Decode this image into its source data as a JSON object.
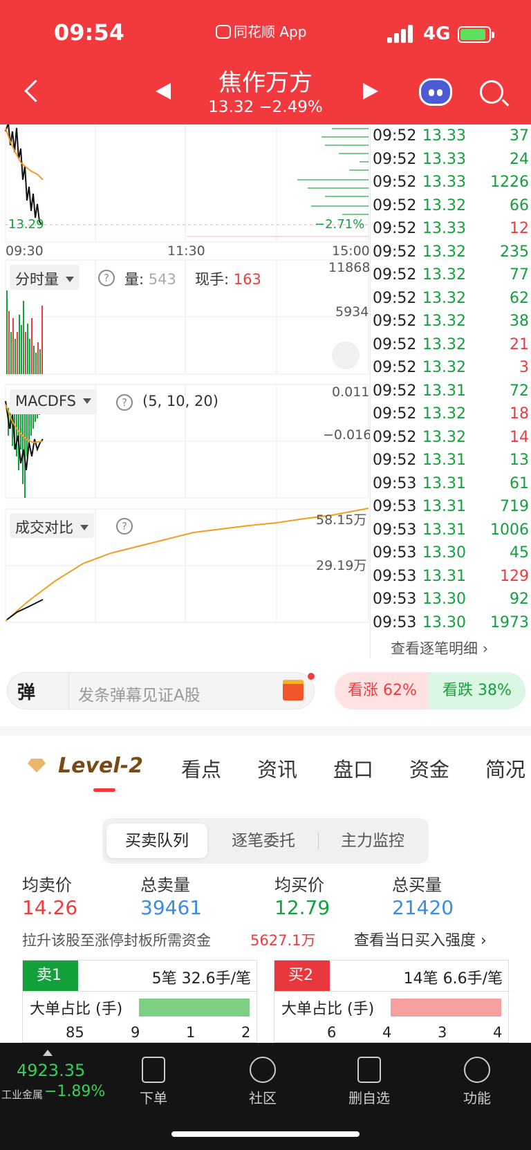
{
  "status": {
    "time": "09:54",
    "app": "同花顺 App",
    "network": "4G"
  },
  "header": {
    "title": "焦作万方",
    "price_change": "13.32  −2.49%"
  },
  "chart": {
    "price_label": "13.29",
    "pct_label": "−2.71%",
    "time_start": "09:30",
    "time_mid": "11:30",
    "time_end": "15:00",
    "volume_panel": {
      "selector": "分时量",
      "vol_label": "量:",
      "vol_value": "543",
      "cur_label": "现手:",
      "cur_value": "163",
      "axis_top": "11868",
      "axis_mid": "5934"
    },
    "macd_panel": {
      "selector": "MACDFS",
      "params": "(5, 10, 20)",
      "axis_top": "0.011",
      "axis_mid": "−0.016"
    },
    "compare_panel": {
      "selector": "成交对比",
      "axis_top": "58.15万",
      "axis_mid": "29.19万"
    },
    "colors": {
      "up": "#f2393d",
      "down": "#12a13a",
      "avg": "#f39c1f"
    }
  },
  "ticks": {
    "rows": [
      {
        "time": "09:52",
        "price": "13.33",
        "vol": "37",
        "dir": "down"
      },
      {
        "time": "09:52",
        "price": "13.33",
        "vol": "24",
        "dir": "down"
      },
      {
        "time": "09:52",
        "price": "13.33",
        "vol": "1226",
        "dir": "down"
      },
      {
        "time": "09:52",
        "price": "13.32",
        "vol": "66",
        "dir": "down"
      },
      {
        "time": "09:52",
        "price": "13.33",
        "vol": "12",
        "dir": "up"
      },
      {
        "time": "09:52",
        "price": "13.32",
        "vol": "235",
        "dir": "down"
      },
      {
        "time": "09:52",
        "price": "13.32",
        "vol": "77",
        "dir": "down"
      },
      {
        "time": "09:52",
        "price": "13.32",
        "vol": "62",
        "dir": "down"
      },
      {
        "time": "09:52",
        "price": "13.32",
        "vol": "38",
        "dir": "down"
      },
      {
        "time": "09:52",
        "price": "13.32",
        "vol": "21",
        "dir": "up"
      },
      {
        "time": "09:52",
        "price": "13.32",
        "vol": "3",
        "dir": "up"
      },
      {
        "time": "09:52",
        "price": "13.31",
        "vol": "72",
        "dir": "down"
      },
      {
        "time": "09:52",
        "price": "13.32",
        "vol": "18",
        "dir": "up"
      },
      {
        "time": "09:52",
        "price": "13.32",
        "vol": "14",
        "dir": "up"
      },
      {
        "time": "09:52",
        "price": "13.31",
        "vol": "13",
        "dir": "down"
      },
      {
        "time": "09:53",
        "price": "13.31",
        "vol": "61",
        "dir": "down"
      },
      {
        "time": "09:53",
        "price": "13.31",
        "vol": "719",
        "dir": "down"
      },
      {
        "time": "09:53",
        "price": "13.31",
        "vol": "1006",
        "dir": "down"
      },
      {
        "time": "09:53",
        "price": "13.30",
        "vol": "45",
        "dir": "down"
      },
      {
        "time": "09:53",
        "price": "13.31",
        "vol": "129",
        "dir": "up"
      },
      {
        "time": "09:53",
        "price": "13.30",
        "vol": "92",
        "dir": "down"
      },
      {
        "time": "09:53",
        "price": "13.30",
        "vol": "1973",
        "dir": "down"
      }
    ],
    "more": "查看逐笔明细"
  },
  "danmu": {
    "icon": "弹",
    "placeholder": "发条弹幕见证A股",
    "rise": "看涨 62%",
    "fall": "看跌 38%"
  },
  "tabs": {
    "level2": "Level-2",
    "items": [
      "看点",
      "资讯",
      "盘口",
      "资金",
      "简况"
    ]
  },
  "segments": [
    "买卖队列",
    "逐笔委托",
    "主力监控"
  ],
  "stats": [
    {
      "label": "均卖价",
      "value": "14.26",
      "color": "#f2393d"
    },
    {
      "label": "总卖量",
      "value": "39461",
      "color": "#3a8be6"
    },
    {
      "label": "均买价",
      "value": "12.79",
      "color": "#12a13a"
    },
    {
      "label": "总买量",
      "value": "21420",
      "color": "#3a8be6"
    }
  ],
  "note": {
    "text": "拉升该股至涨停封板所需资金",
    "value": "5627.1万",
    "link": "查看当日买入强度"
  },
  "queues": [
    {
      "head": "卖1",
      "head_color": "#12a13a",
      "info": "5笔  32.6手/笔",
      "big": "大单占比 (手)",
      "bar_color": "#7dd083",
      "nums": [
        "85",
        "9",
        "1",
        "2"
      ]
    },
    {
      "head": "买2",
      "head_color": "#e8383d",
      "info": "14笔  6.6手/笔",
      "big": "大单占比 (手)",
      "bar_color": "#f5a0a0",
      "nums": [
        "6",
        "4",
        "3",
        "4"
      ]
    }
  ],
  "bottom": {
    "index_value": "4923.35",
    "index_name": "工业金属",
    "index_change": "−1.89%",
    "nav": [
      "下单",
      "社区",
      "删自选",
      "功能"
    ]
  }
}
